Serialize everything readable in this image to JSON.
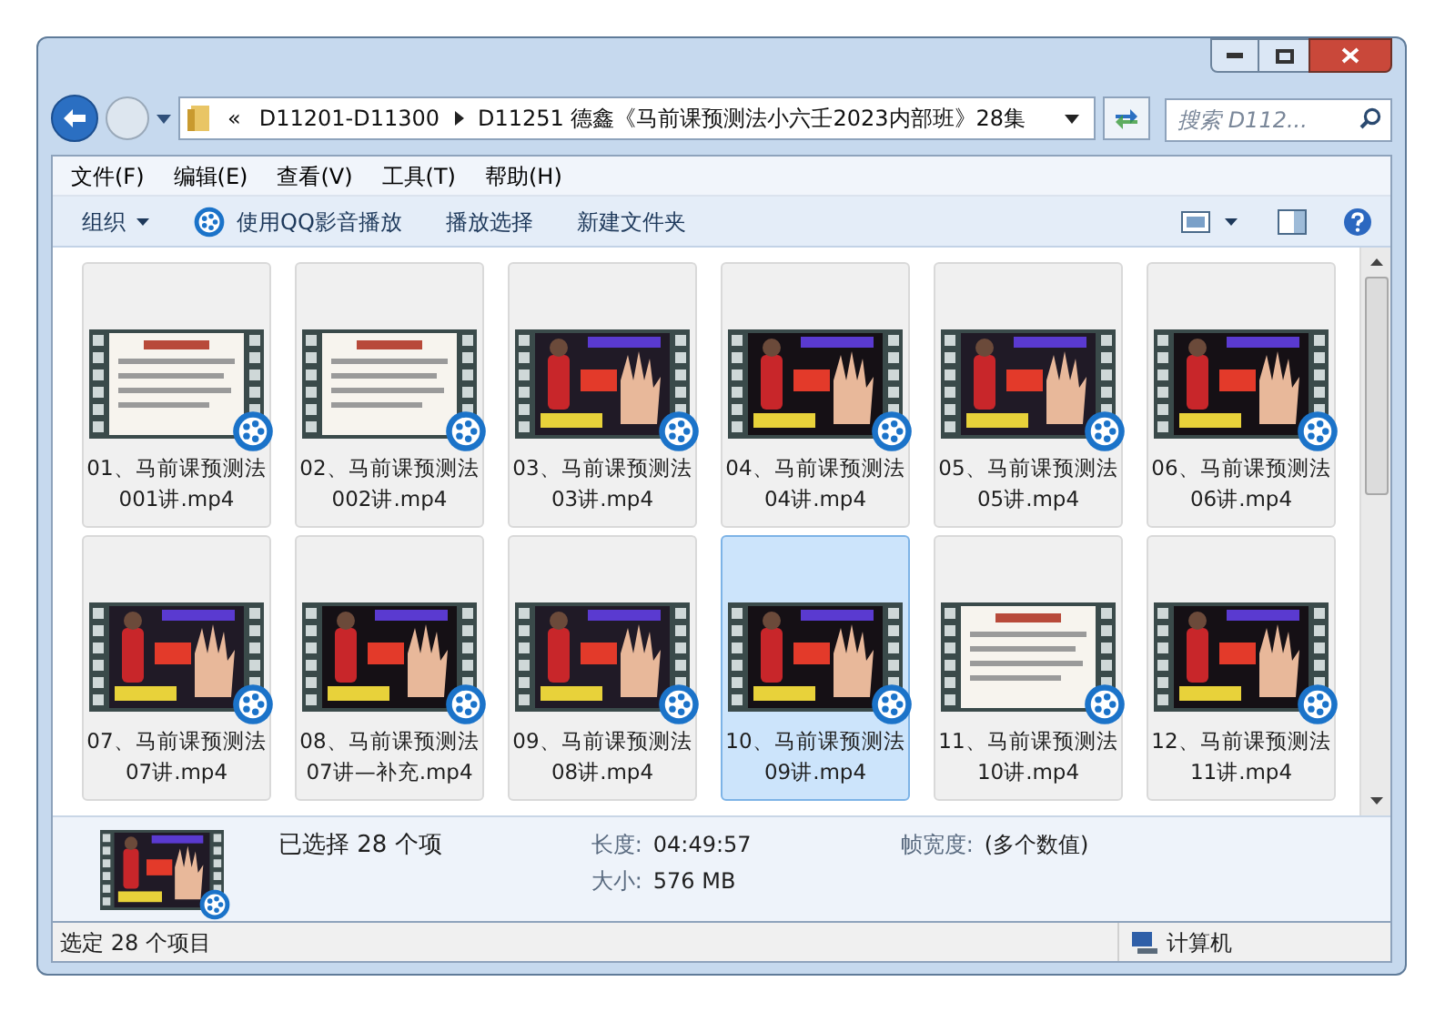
{
  "address": {
    "overflow": "«",
    "crumbs": [
      "D11201-D11300",
      "D11251 德鑫《马前课预测法小六壬2023内部班》28集"
    ]
  },
  "search": {
    "placeholder": "搜索 D112..."
  },
  "menu": [
    "文件(F)",
    "编辑(E)",
    "查看(V)",
    "工具(T)",
    "帮助(H)"
  ],
  "toolbar": [
    {
      "label": "组织",
      "kind": "dropdown"
    },
    {
      "label": "使用QQ影音播放",
      "kind": "player"
    },
    {
      "label": "播放选择",
      "kind": "plain"
    },
    {
      "label": "新建文件夹",
      "kind": "plain"
    }
  ],
  "files": [
    {
      "name": "01、马前课预测法001讲.mp4",
      "kind": "text",
      "selected": true,
      "hot": false
    },
    {
      "name": "02、马前课预测法002讲.mp4",
      "kind": "text",
      "selected": true,
      "hot": false
    },
    {
      "name": "03、马前课预测法03讲.mp4",
      "kind": "video",
      "selected": true,
      "hot": false
    },
    {
      "name": "04、马前课预测法04讲.mp4",
      "kind": "video",
      "selected": true,
      "hot": false
    },
    {
      "name": "05、马前课预测法05讲.mp4",
      "kind": "video",
      "selected": true,
      "hot": false
    },
    {
      "name": "06、马前课预测法06讲.mp4",
      "kind": "video",
      "selected": true,
      "hot": false
    },
    {
      "name": "07、马前课预测法07讲.mp4",
      "kind": "video",
      "selected": true,
      "hot": false
    },
    {
      "name": "08、马前课预测法07讲—补充.mp4",
      "kind": "video",
      "selected": true,
      "hot": false
    },
    {
      "name": "09、马前课预测法08讲.mp4",
      "kind": "video",
      "selected": true,
      "hot": false
    },
    {
      "name": "10、马前课预测法09讲.mp4",
      "kind": "video",
      "selected": true,
      "hot": true
    },
    {
      "name": "11、马前课预测法10讲.mp4",
      "kind": "text",
      "selected": true,
      "hot": false
    },
    {
      "name": "12、马前课预测法11讲.mp4",
      "kind": "video",
      "selected": true,
      "hot": false
    }
  ],
  "details": {
    "summary": "已选择 28 个项",
    "fields": [
      {
        "label": "长度:",
        "value": "04:49:57"
      },
      {
        "label": "大小:",
        "value": "576 MB"
      },
      {
        "label": "帧宽度:",
        "value": "(多个数值)"
      }
    ]
  },
  "status_bar": {
    "text": "选定 28 个项目",
    "location": "计算机"
  }
}
